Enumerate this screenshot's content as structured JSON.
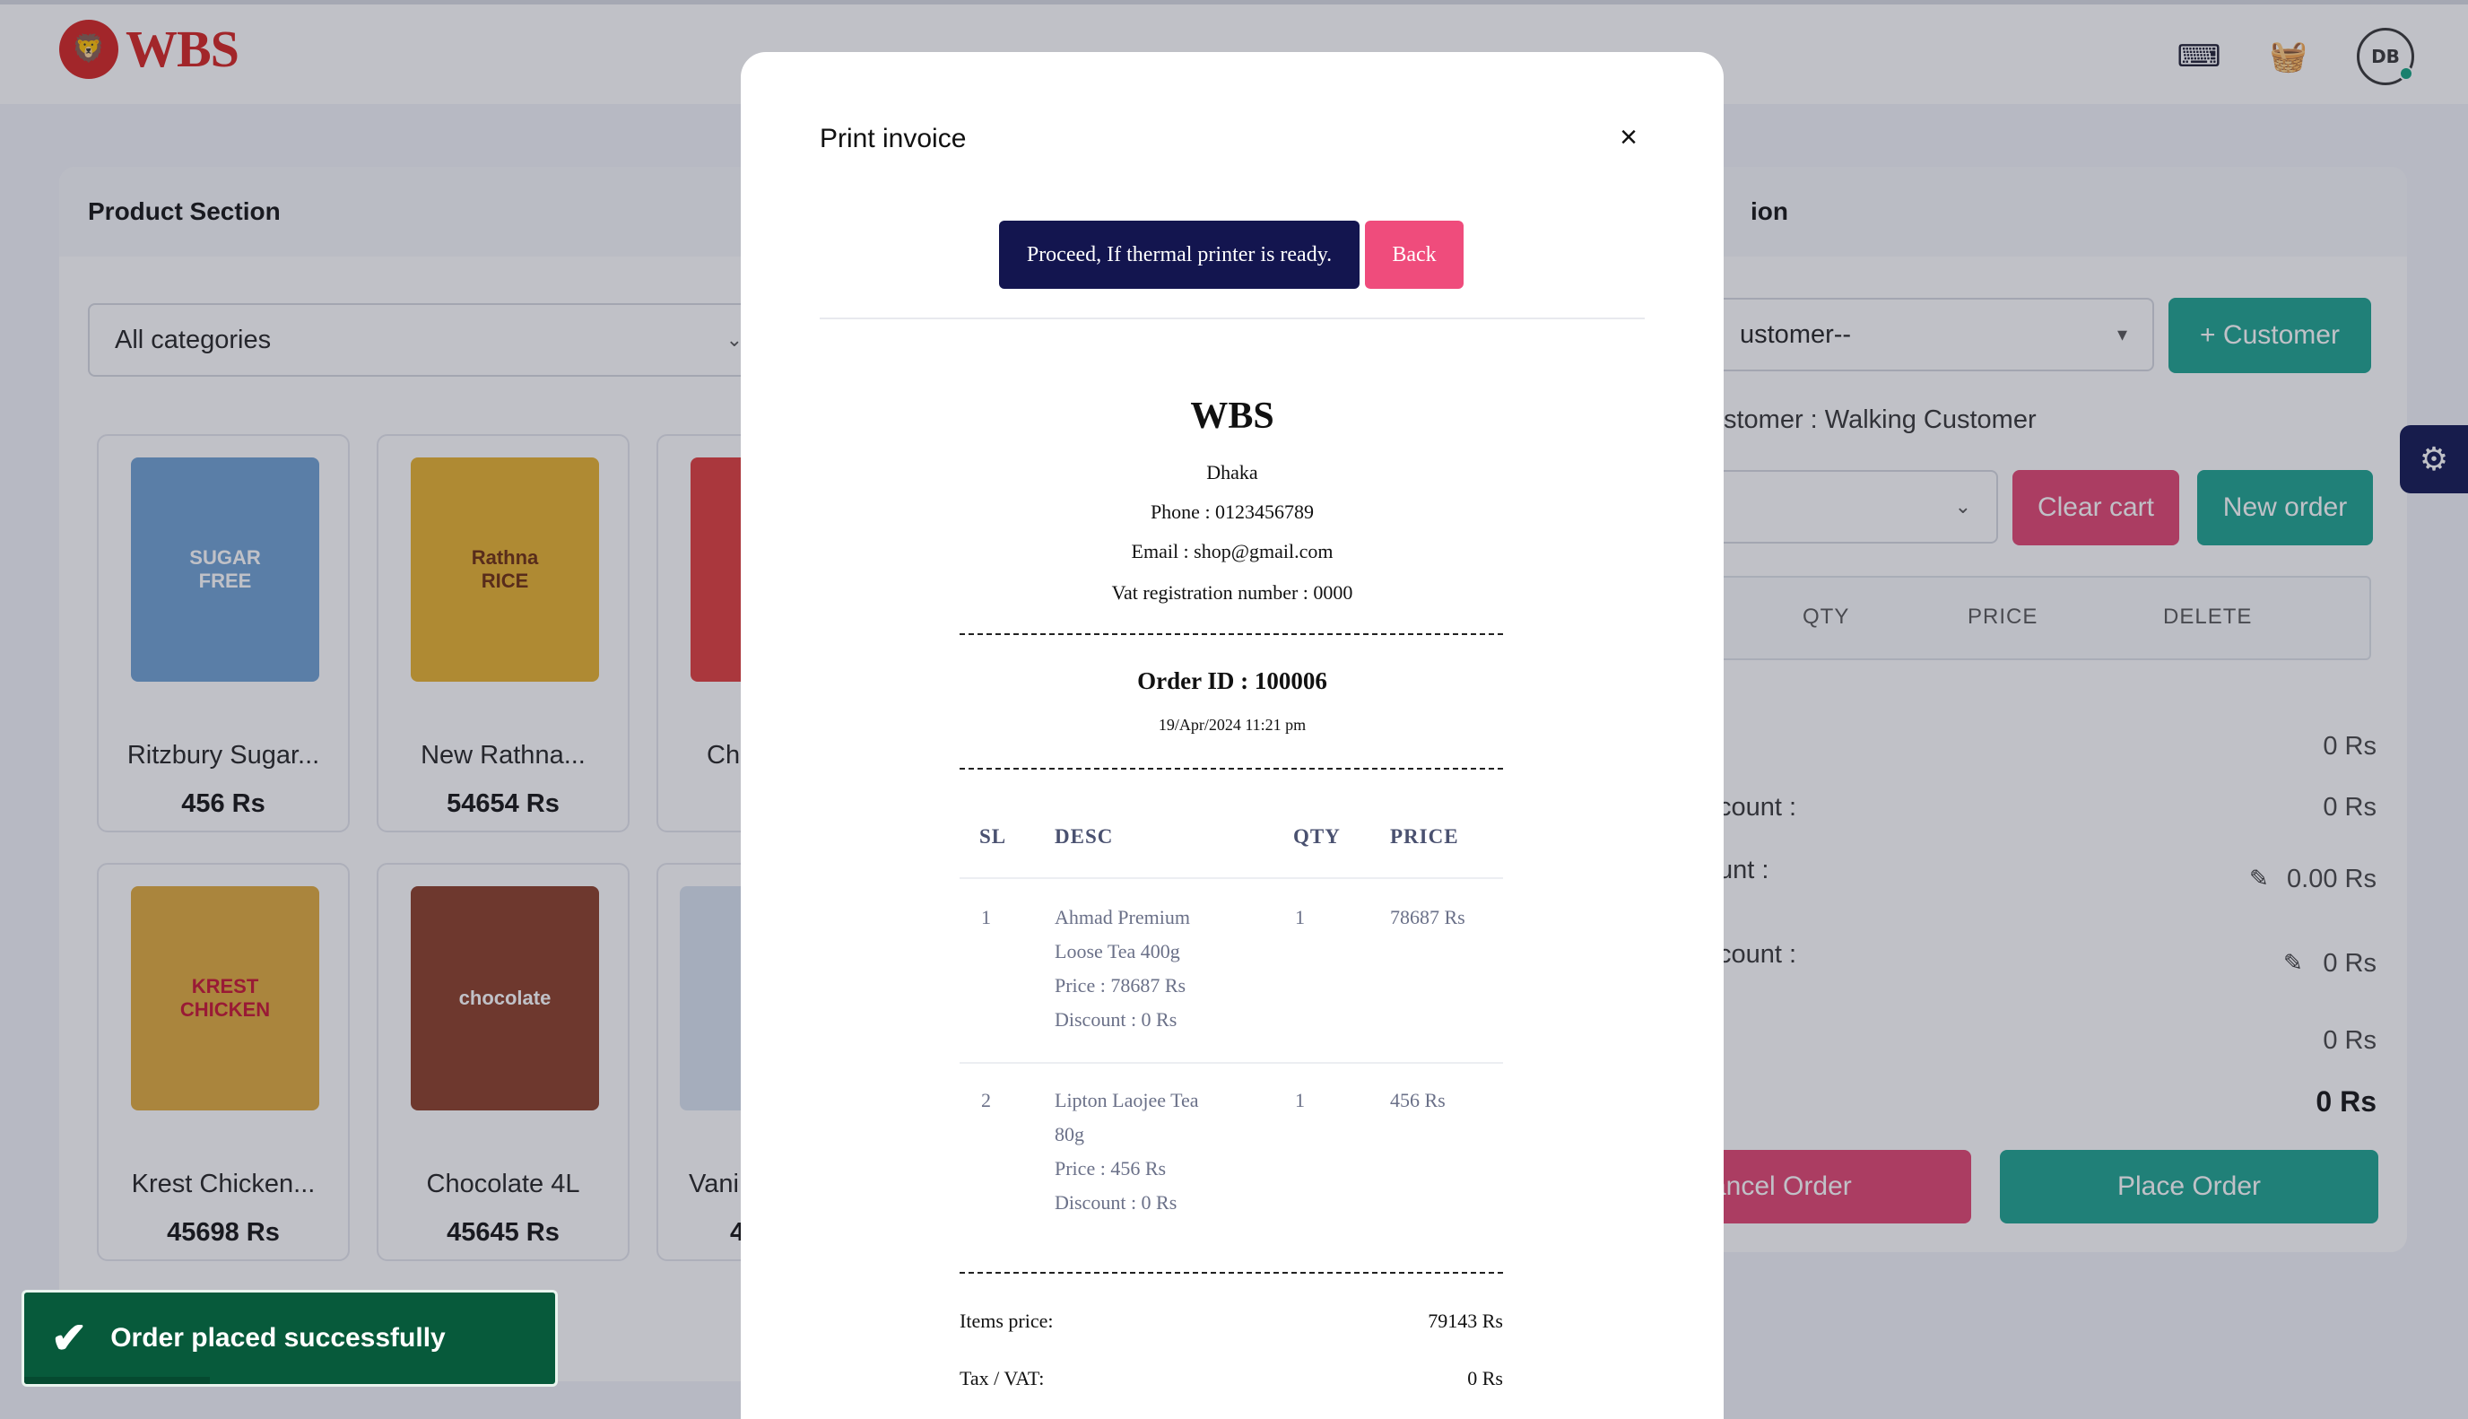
{
  "app": {
    "logo_text": "WBS",
    "icons": [
      "keyboard-icon",
      "basket-icon",
      "avatar"
    ]
  },
  "products": {
    "title": "Product Section",
    "category_select": "All categories",
    "items": [
      {
        "name": "Ritzbury Sugar...",
        "price": "456 Rs",
        "color": "#6e9fd1"
      },
      {
        "name": "New Rathna...",
        "price": "54654 Rs",
        "color": "#e7b12c"
      },
      {
        "name": "Chu",
        "price": "",
        "color": "#e03a3a"
      },
      {
        "name": "Krest Chicken...",
        "price": "45698 Rs",
        "color": "#e0a93a"
      },
      {
        "name": "Chocolate 4L",
        "price": "45645 Rs",
        "color": "#8a3b25"
      },
      {
        "name": "Vani",
        "price": "4",
        "color": "#d9e3ef"
      }
    ]
  },
  "billing": {
    "title": "ion",
    "customer_select": "ustomer--",
    "add_customer": "+ Customer",
    "current_customer": "stomer : Walking Customer",
    "clear_cart": "Clear cart",
    "new_order": "New order",
    "columns": [
      "QTY",
      "PRICE",
      "DELETE"
    ],
    "summary": [
      {
        "label": "",
        "value": "0 Rs"
      },
      {
        "label": "count :",
        "value": "0 Rs"
      },
      {
        "label": "unt :",
        "value": "0.00 Rs"
      },
      {
        "label": "count :",
        "value": "0 Rs"
      },
      {
        "label": "",
        "value": "0 Rs"
      },
      {
        "label": "",
        "value": "0 Rs"
      }
    ],
    "cancel_order": "ancel Order",
    "place_order": "Place Order"
  },
  "toast": {
    "message": "Order placed successfully",
    "progress": 0.35
  },
  "modal": {
    "title": "Print invoice",
    "close": "×",
    "proceed": "Proceed, If thermal printer is ready.",
    "back": "Back",
    "invoice": {
      "shop": "WBS",
      "address": "Dhaka",
      "phone": "Phone : 0123456789",
      "email": "Email : shop@gmail.com",
      "vat": "Vat registration number : 0000",
      "order_id": "Order ID : 100006",
      "datetime": "19/Apr/2024 11:21 pm",
      "headers": [
        "SL",
        "DESC",
        "QTY",
        "PRICE"
      ],
      "rows": [
        {
          "sl": "1",
          "desc": [
            "Ahmad Premium",
            "Loose Tea 400g",
            "Price : 78687 Rs",
            "Discount : 0 Rs"
          ],
          "qty": "1",
          "price": "78687 Rs"
        },
        {
          "sl": "2",
          "desc": [
            "Lipton Laojee Tea",
            "80g",
            "Price : 456 Rs",
            "Discount : 0 Rs"
          ],
          "qty": "1",
          "price": "456 Rs"
        }
      ],
      "items_price_label": "Items price:",
      "items_price": "79143 Rs",
      "tax_label": "Tax / VAT:",
      "tax": "0 Rs"
    }
  }
}
